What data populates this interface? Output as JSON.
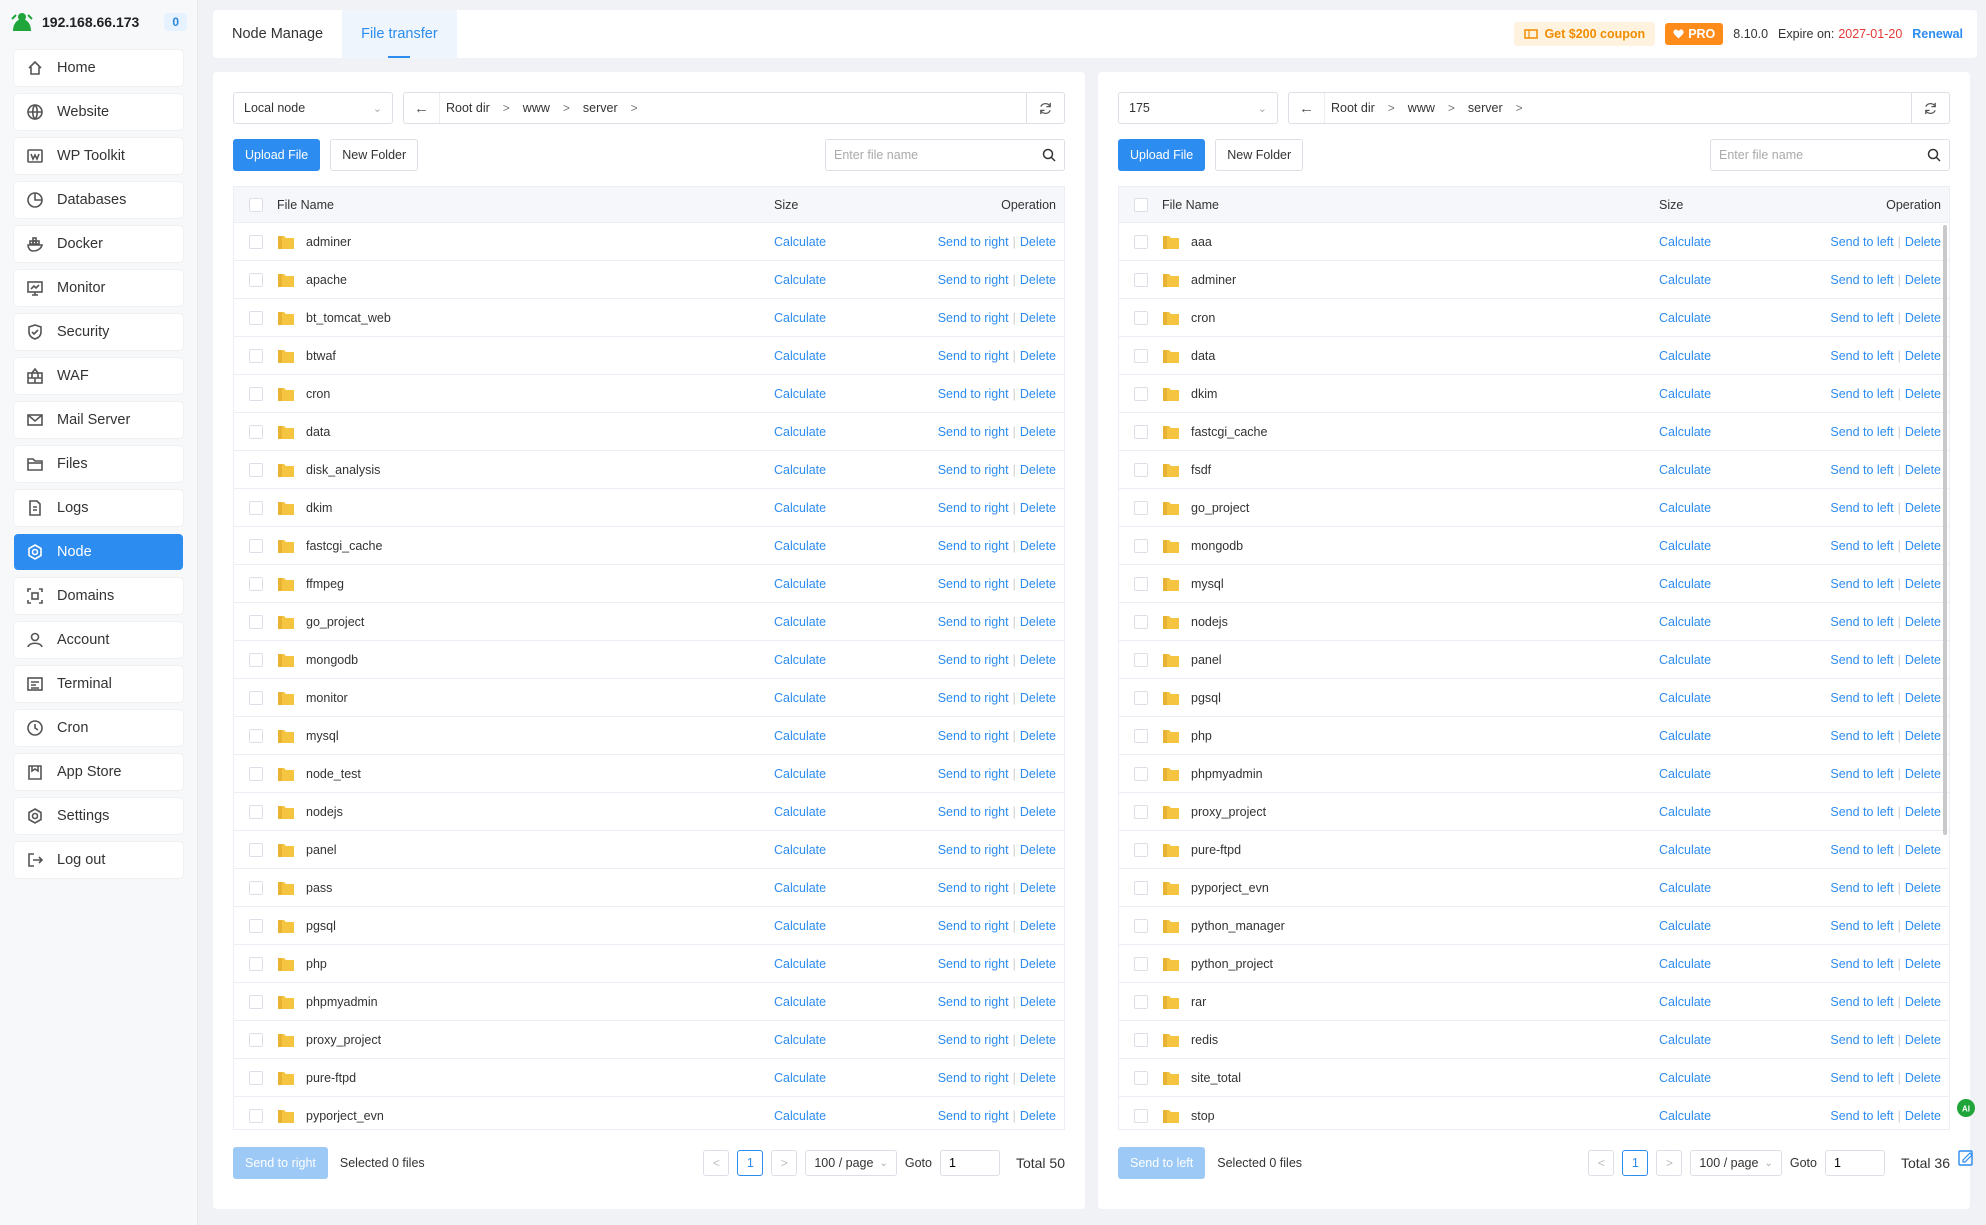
{
  "header": {
    "ip": "192.168.66.173",
    "badge": "0"
  },
  "nav": [
    {
      "label": "Home",
      "icon": "home-icon"
    },
    {
      "label": "Website",
      "icon": "globe-icon"
    },
    {
      "label": "WP Toolkit",
      "icon": "wordpress-icon"
    },
    {
      "label": "Databases",
      "icon": "database-icon"
    },
    {
      "label": "Docker",
      "icon": "docker-icon"
    },
    {
      "label": "Monitor",
      "icon": "monitor-icon"
    },
    {
      "label": "Security",
      "icon": "shield-icon"
    },
    {
      "label": "WAF",
      "icon": "firewall-icon"
    },
    {
      "label": "Mail Server",
      "icon": "mail-icon"
    },
    {
      "label": "Files",
      "icon": "folder-icon"
    },
    {
      "label": "Logs",
      "icon": "logs-icon"
    },
    {
      "label": "Node",
      "icon": "node-icon",
      "active": true
    },
    {
      "label": "Domains",
      "icon": "domains-icon"
    },
    {
      "label": "Account",
      "icon": "user-icon"
    },
    {
      "label": "Terminal",
      "icon": "terminal-icon"
    },
    {
      "label": "Cron",
      "icon": "clock-icon"
    },
    {
      "label": "App Store",
      "icon": "store-icon"
    },
    {
      "label": "Settings",
      "icon": "gear-icon"
    },
    {
      "label": "Log out",
      "icon": "logout-icon"
    }
  ],
  "tabs": [
    {
      "label": "Node Manage"
    },
    {
      "label": "File transfer",
      "active": true
    }
  ],
  "topbar": {
    "coupon": "Get $200 coupon",
    "pro": "PRO",
    "version": "8.10.0",
    "expire_label": "Expire on:",
    "expire_date": "2027-01-20",
    "renewal": "Renewal"
  },
  "colors": {
    "accent": "#2d8cf0",
    "pro": "#ff8c1a",
    "expire": "#e53935",
    "folder": "#f5c542"
  },
  "left": {
    "node": "Local node",
    "breadcrumb": [
      "Root dir",
      "www",
      "server"
    ],
    "upload": "Upload File",
    "new_folder": "New Folder",
    "search_placeholder": "Enter file name",
    "headers": {
      "name": "File Name",
      "size": "Size",
      "op": "Operation"
    },
    "calc": "Calculate",
    "send": "Send to right",
    "del": "Delete",
    "files": [
      "adminer",
      "apache",
      "bt_tomcat_web",
      "btwaf",
      "cron",
      "data",
      "disk_analysis",
      "dkim",
      "fastcgi_cache",
      "ffmpeg",
      "go_project",
      "mongodb",
      "monitor",
      "mysql",
      "node_test",
      "nodejs",
      "panel",
      "pass",
      "pgsql",
      "php",
      "phpmyadmin",
      "proxy_project",
      "pure-ftpd",
      "pyporject_evn"
    ],
    "send_btn": "Send to right",
    "selected": "Selected 0 files",
    "page": "1",
    "page_size": "100 / page",
    "goto_label": "Goto",
    "goto_value": "1",
    "total": "Total 50"
  },
  "right": {
    "node": "175",
    "breadcrumb": [
      "Root dir",
      "www",
      "server"
    ],
    "upload": "Upload File",
    "new_folder": "New Folder",
    "search_placeholder": "Enter file name",
    "headers": {
      "name": "File Name",
      "size": "Size",
      "op": "Operation"
    },
    "calc": "Calculate",
    "send": "Send to left",
    "del": "Delete",
    "files": [
      "aaa",
      "adminer",
      "cron",
      "data",
      "dkim",
      "fastcgi_cache",
      "fsdf",
      "go_project",
      "mongodb",
      "mysql",
      "nodejs",
      "panel",
      "pgsql",
      "php",
      "phpmyadmin",
      "proxy_project",
      "pure-ftpd",
      "pyporject_evn",
      "python_manager",
      "python_project",
      "rar",
      "redis",
      "site_total",
      "stop"
    ],
    "send_btn": "Send to left",
    "selected": "Selected 0 files",
    "page": "1",
    "page_size": "100 / page",
    "goto_label": "Goto",
    "goto_value": "1",
    "total": "Total 36"
  }
}
